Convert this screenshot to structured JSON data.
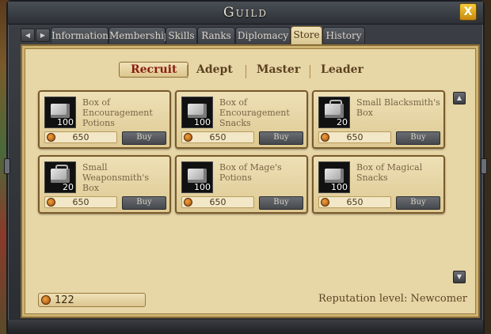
{
  "window": {
    "title": "Guild",
    "close_label": "X"
  },
  "tabs": {
    "prev_label": "◀",
    "next_label": "▶",
    "items": [
      {
        "label": "Information"
      },
      {
        "label": "Membership"
      },
      {
        "label": "Skills"
      },
      {
        "label": "Ranks"
      },
      {
        "label": "Diplomacy"
      },
      {
        "label": "Store"
      },
      {
        "label": "History"
      }
    ],
    "active": "Store"
  },
  "subtabs": {
    "items": [
      {
        "label": "Recruit"
      },
      {
        "label": "Adept"
      },
      {
        "label": "Master"
      },
      {
        "label": "Leader"
      }
    ],
    "active": "Recruit"
  },
  "store": {
    "items": [
      {
        "name": "Box of Encouragement Potions",
        "qty": "100",
        "price": "650",
        "buy": "Buy",
        "icon": "box-icon"
      },
      {
        "name": "Box of Encouragement Snacks",
        "qty": "100",
        "price": "650",
        "buy": "Buy",
        "icon": "box-icon"
      },
      {
        "name": "Small Blacksmith's Box",
        "qty": "20",
        "price": "650",
        "buy": "Buy",
        "icon": "toolbox-icon"
      },
      {
        "name": "Small Weaponsmith's Box",
        "qty": "20",
        "price": "650",
        "buy": "Buy",
        "icon": "toolbox-icon"
      },
      {
        "name": "Box of Mage's Potions",
        "qty": "100",
        "price": "650",
        "buy": "Buy",
        "icon": "box-icon"
      },
      {
        "name": "Box of Magical Snacks",
        "qty": "100",
        "price": "650",
        "buy": "Buy",
        "icon": "box-icon"
      }
    ]
  },
  "footer": {
    "reputation_points": "122",
    "reputation_level": "Reputation level: Newcomer"
  },
  "scrollbar": {
    "up_label": "▲",
    "down_label": "▼"
  },
  "colors": {
    "accent_active": "#8a1e12",
    "panel_bg": "#e7d6a6",
    "frame_bg": "#2a2d31"
  }
}
